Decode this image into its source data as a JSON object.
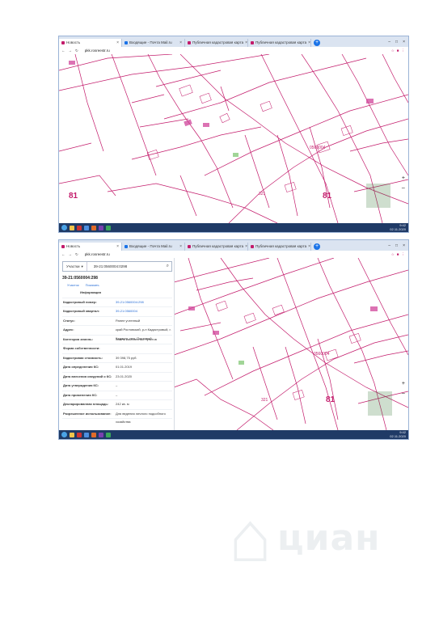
{
  "browser": {
    "tabs": [
      {
        "label": "Новость",
        "favicon_color": "#c31b6b"
      },
      {
        "label": "Входящие - Почта Mail.ru",
        "favicon_color": "#1a73e8"
      },
      {
        "label": "Публичная кадастровая карта",
        "favicon_color": "#c31b6b"
      },
      {
        "label": "Публичная кадастровая карта",
        "favicon_color": "#c31b6b"
      }
    ],
    "url": "pkk.rosreestr.ru",
    "newtab_symbol": "+",
    "window_controls": [
      "–",
      "□",
      "×"
    ]
  },
  "map": {
    "district_labels": [
      "81",
      "81"
    ],
    "quarter_label": "0560004",
    "parcel_label": "321",
    "zoom_in": "+",
    "zoom_out": "–"
  },
  "taskbar": {
    "time": "9:42",
    "date": "02.11.2020"
  },
  "panel": {
    "search_type": "Участки",
    "search_value": "39-21:0560004:0298",
    "object_title": "39-21:0560004:298",
    "object_tabs": [
      "Участок",
      "Показать"
    ],
    "rows": [
      {
        "key": "Информация",
        "value": ""
      },
      {
        "key": "Кадастровый номер:",
        "value": "39-21:0560004:298",
        "link": true
      },
      {
        "key": "Кадастровый квартал:",
        "value": "39-21:0560004",
        "link": true
      },
      {
        "key": "Статус:",
        "value": "Ранее учтенный"
      },
      {
        "key": "Адрес:",
        "value": "край Ростовский, р-н Кадастровый, г. Кадастр, пер. Почтовый"
      },
      {
        "key": "Категория земель:",
        "value": "Земли населенных пунктов"
      },
      {
        "key": "Форма собственности:",
        "value": ""
      },
      {
        "key": "Кадастровая стоимость:",
        "value": "39 398,75 руб."
      },
      {
        "key": "Дата определения КС:",
        "value": "01.01.2019"
      },
      {
        "key": "Дата внесения сведений о КС:",
        "value": "23.01.2020"
      },
      {
        "key": "Дата утверждения КС:",
        "value": "–"
      },
      {
        "key": "Дата применения КС:",
        "value": "–"
      },
      {
        "key": "Декларированная площадь:",
        "value": "242 кв. м"
      },
      {
        "key": "Разрешенное использование:",
        "value": "Для ведения личного подсобного хозяйства"
      }
    ]
  },
  "watermark": {
    "word": "циан"
  }
}
